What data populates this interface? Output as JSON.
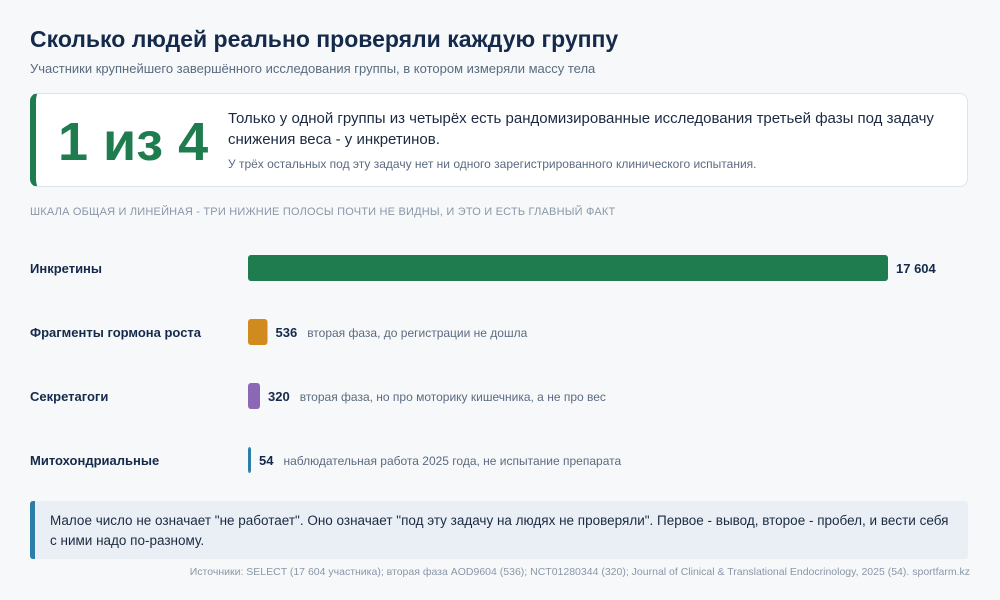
{
  "header": {
    "title": "Сколько людей реально проверяли каждую группу",
    "subtitle": "Участники крупнейшего завершённого исследования группы, в котором измеряли массу тела"
  },
  "callout": {
    "big": "1 из 4",
    "main": "Только у одной группы из четырёх есть рандомизированные исследования третьей фазы под задачу снижения веса - у инкретинов.",
    "sub": "У трёх остальных под эту задачу нет ни одного зарегистрированного клинического испытания."
  },
  "scale_note": "ШКАЛА ОБЩАЯ И ЛИНЕЙНАЯ - ТРИ НИЖНИЕ ПОЛОСЫ ПОЧТИ НЕ ВИДНЫ, И ЭТО И ЕСТЬ ГЛАВНЫЙ ФАКТ",
  "chart_data": {
    "type": "bar",
    "orientation": "horizontal",
    "scale": "linear",
    "categories": [
      "Инкретины",
      "Фрагменты гормона роста",
      "Секретагоги",
      "Митохондриальные"
    ],
    "values": [
      17604,
      536,
      320,
      54
    ],
    "value_labels": [
      "17 604",
      "536",
      "320",
      "54"
    ],
    "notes": [
      "",
      "вторая фаза, до регистрации не дошла",
      "вторая фаза, но про моторику кишечника, а не про вес",
      "наблюдательная работа 2025 года, не испытание препарата"
    ],
    "colors": [
      "#1e7c4e",
      "#d08a1e",
      "#8a68b6",
      "#2b7ea8"
    ],
    "grid": false
  },
  "footer": {
    "text": "Малое число не означает \"не работает\". Оно означает \"под эту задачу на людях не проверяли\". Первое - вывод, второе - пробел, и вести себя с ними надо по-разному.",
    "sources": "Источники: SELECT (17 604 участника); вторая фаза AOD9604 (536); NCT01280344 (320); Journal of Clinical & Translational Endocrinology, 2025 (54). sportfarm.kz"
  }
}
